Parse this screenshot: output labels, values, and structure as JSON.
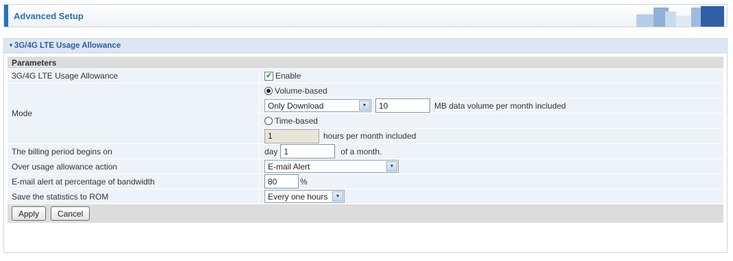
{
  "header": {
    "title": "Advanced Setup"
  },
  "panel": {
    "title": "3G/4G LTE Usage Allowance",
    "section": "Parameters"
  },
  "rows": {
    "allowance": {
      "label": "3G/4G LTE Usage Allowance",
      "checkbox_label": "Enable",
      "checked": true
    },
    "mode": {
      "label": "Mode",
      "volume_label": "Volume-based",
      "volume_selected": true,
      "volume_select": "Only Download",
      "volume_value": "10",
      "volume_suffix": "MB data volume per month included",
      "time_label": "Time-based",
      "time_selected": false,
      "time_value": "1",
      "time_suffix": "hours per month included"
    },
    "billing": {
      "label": "The billing period begins on",
      "prefix": "day",
      "value": "1",
      "suffix": "of a month."
    },
    "over_usage": {
      "label": "Over usage allowance action",
      "select": "E-mail Alert"
    },
    "email_alert": {
      "label": "E-mail alert at percentage of bandwidth",
      "value": "80",
      "suffix": "%"
    },
    "save_stats": {
      "label": "Save the statistics to ROM",
      "select": "Every one hours"
    }
  },
  "buttons": {
    "apply": "Apply",
    "cancel": "Cancel"
  },
  "colors": {
    "accent": "#1f73c4",
    "panel_header": "#dde7f2",
    "row_bg": "#eef3f9"
  },
  "icons": {
    "checkbox_check": "✔",
    "select_arrow": "▼",
    "collapse": "▼"
  }
}
